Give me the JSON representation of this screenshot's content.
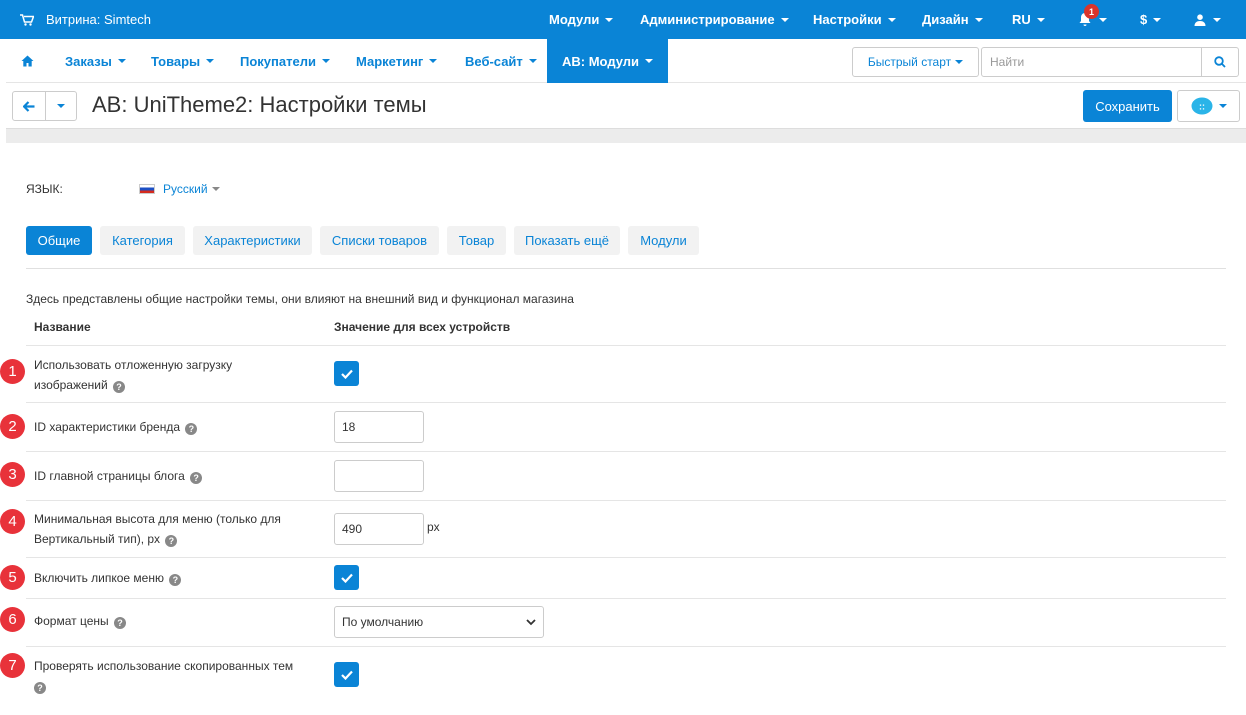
{
  "topbar": {
    "store_label": "Витрина: Simtech",
    "menus": [
      "Модули",
      "Администрирование",
      "Настройки",
      "Дизайн",
      "RU"
    ],
    "notifications_count": "1",
    "currency": "$"
  },
  "mainnav": {
    "items": [
      "Заказы",
      "Товары",
      "Покупатели",
      "Маркетинг",
      "Веб-сайт",
      "AB: Модули"
    ],
    "quickstart": "Быстрый старт",
    "search_placeholder": "Найти"
  },
  "titlebar": {
    "title": "AB: UniTheme2: Настройки темы",
    "save_label": "Сохранить"
  },
  "language": {
    "label": "ЯЗЫК:",
    "value": "Русский"
  },
  "tabs": [
    "Общие",
    "Категория",
    "Характеристики",
    "Списки товаров",
    "Товар",
    "Показать ещё",
    "Модули"
  ],
  "description": "Здесь представлены общие настройки темы, они влияют на внешний вид и функционал магазина",
  "table": {
    "col_name": "Название",
    "col_value": "Значение для всех устройств"
  },
  "settings": [
    {
      "num": "1",
      "label_line1": "Использовать отложенную загрузку",
      "label_line2": "изображений",
      "type": "checkbox",
      "checked": true
    },
    {
      "num": "2",
      "label": "ID характеристики бренда",
      "type": "text",
      "value": "18"
    },
    {
      "num": "3",
      "label": "ID главной страницы блога",
      "type": "text",
      "value": ""
    },
    {
      "num": "4",
      "label_line1": "Минимальная высота для меню (только для",
      "label_line2": "Вертикальный тип), px",
      "type": "text",
      "value": "490",
      "unit": "px"
    },
    {
      "num": "5",
      "label": "Включить липкое меню",
      "type": "checkbox",
      "checked": true
    },
    {
      "num": "6",
      "label": "Формат цены",
      "type": "select",
      "value": "По умолчанию"
    },
    {
      "num": "7",
      "label": "Проверять использование скопированных тем",
      "type": "checkbox",
      "checked": true
    }
  ],
  "colors": {
    "accent": "#0a84d6",
    "badge_red": "#e8323a"
  }
}
